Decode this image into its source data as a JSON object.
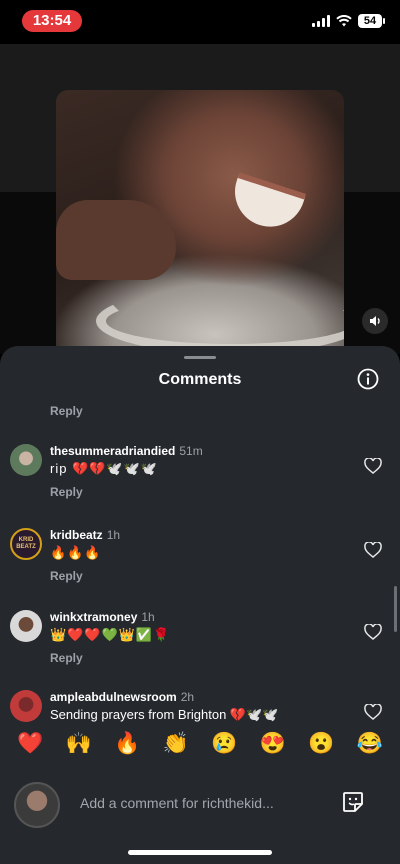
{
  "status_bar": {
    "time": "13:54",
    "battery": "54"
  },
  "sheet": {
    "title": "Comments",
    "top_reply": "Reply"
  },
  "comments": [
    {
      "username": "thesummeradriandied",
      "time": "51m",
      "text": "rip 💔💔🕊️🕊️🕊️",
      "reply": "Reply",
      "avatar_color": "#5e7a5c"
    },
    {
      "username": "kridbeatz",
      "time": "1h",
      "text": "🔥🔥🔥",
      "reply": "Reply",
      "avatar_color": "#2a1a2e"
    },
    {
      "username": "winkxtramoney",
      "time": "1h",
      "text": "👑❤️❤️💚👑✅🌹",
      "reply": "Reply",
      "avatar_color": "#d9d9d9"
    },
    {
      "username": "ampleabdulnewsroom",
      "time": "2h",
      "text": "Sending prayers from Brighton 💔🕊️🕊️",
      "avatar_color": "#c23b3b"
    }
  ],
  "avatar_badges": {
    "kridbeatz": "KRID BEATZ"
  },
  "quick_reactions": [
    "❤️",
    "🙌",
    "🔥",
    "👏",
    "😢",
    "😍",
    "😮",
    "😂"
  ],
  "composer": {
    "placeholder": "Add a comment for richthekid..."
  },
  "colors": {
    "accent_red": "#e5383b",
    "sheet_bg": "#25282d",
    "muted_text": "#9ea2a8"
  },
  "icons": {
    "info": "info-icon",
    "heart": "heart-outline-icon",
    "sticker": "sticker-icon",
    "mute": "speaker-icon",
    "wifi": "wifi-icon",
    "signal": "signal-icon"
  }
}
